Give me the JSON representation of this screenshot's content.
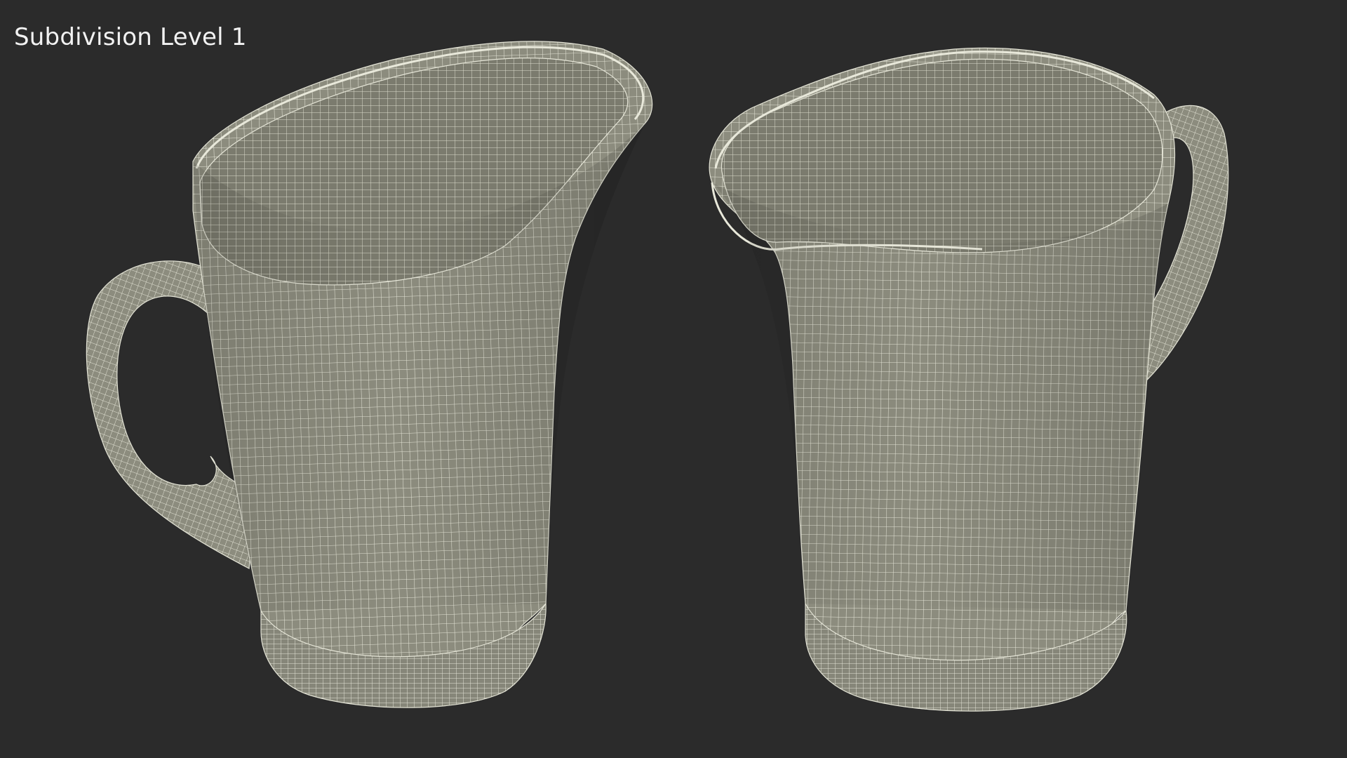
{
  "caption": "Subdivision Level 1",
  "colors": {
    "background": "#2b2b2b",
    "surface": "#8c8c7e",
    "surface_inner": "#7d7d70",
    "wire": "#e4e4d6"
  }
}
